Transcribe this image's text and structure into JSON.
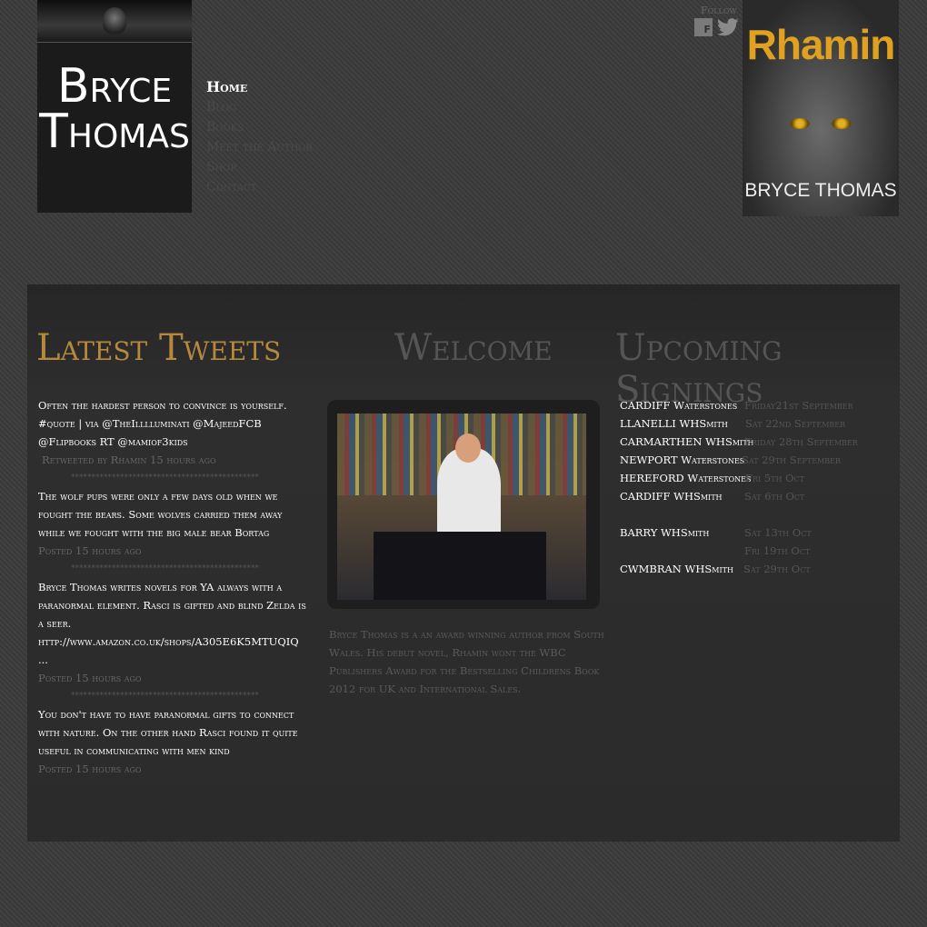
{
  "logo": {
    "line1": "Bryce",
    "line2": "Thomas"
  },
  "nav": [
    "Home",
    "Blog",
    "Books",
    "Meet the Author",
    "Shop",
    "Contact"
  ],
  "social": {
    "follow_label": "Follow",
    "facebook_glyph": "f"
  },
  "book_cover": {
    "title": "Rhamin",
    "author": "BRYCE THOMAS"
  },
  "headings": {
    "tweets": "Latest Tweets",
    "welcome": "Welcome",
    "signings": "Upcoming Signings"
  },
  "tweets": [
    {
      "text": "Often the hardest person to convince is yourself. #quote | via @TheIlllluminati @MajeedFCB @Flipbooks RT @mamiof3kids",
      "meta": "Retweeted by Rhamin 15 hours ago"
    },
    {
      "text": "The wolf pups were only a few days old when we fought the bears. Some wolves carried them away while we fought with the big male bear Bortag",
      "meta": "Posted 15 hours ago"
    },
    {
      "text": "Bryce Thomas writes novels for YA always with a paranormal element. Rasci is gifted and blind Zelda is a seer. http://www.amazon.co.uk/shops/A305E6K5MTUQIQ ...",
      "meta": "Posted 15 hours ago"
    },
    {
      "text": "You don't have to have paranormal gifts to connect with nature. On the other hand Rasci found it quite useful in communicating with men kind",
      "meta": "Posted 15 hours ago"
    }
  ],
  "separator": "**********************************************",
  "welcome": {
    "text": "Bryce Thomas is a an award winning author from South Wales. His debut novel, Rhamin wont the WBC Publishers Award for the Bestselling Childrens Book 2012 for UK and International Sales."
  },
  "signings": [
    {
      "location": "CARDIFF Waterstones",
      "date": "Friday21st September"
    },
    {
      "location": "LLANELLI   WHSmith",
      "date": "Sat 22nd September"
    },
    {
      "location": "CARMARTHEN WHSmith",
      "date": "Friday 28th September"
    },
    {
      "location": "NEWPORT Waterstones",
      "date": "Sat 29th September"
    },
    {
      "location": "HEREFORD Waterstones",
      "date": "Fri 5th Oct"
    },
    {
      "location": "CARDIFF WHSmith",
      "date": "Sat 6th Oct"
    },
    {
      "location": "",
      "date": ""
    },
    {
      "location": "BARRY WHSmith",
      "date": "Sat 13th Oct"
    },
    {
      "location": "",
      "date": "Fri 19th Oct"
    },
    {
      "location": "CWMBRAN WHSmith",
      "date": "Sat 29th Oct"
    }
  ],
  "colors": {
    "accent": "#b7893f",
    "background": "#3a3a3a",
    "panel": "#2b2b2b"
  },
  "icons": [
    "facebook-icon",
    "twitter-icon"
  ]
}
